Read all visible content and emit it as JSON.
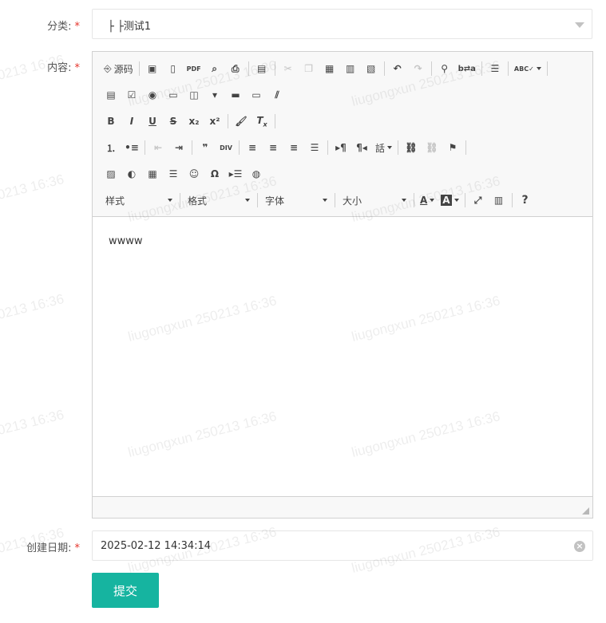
{
  "form": {
    "category_label": "分类:",
    "category_value": "├ ├测试1",
    "content_label": "内容:",
    "date_label": "创建日期:",
    "date_value": "2025-02-12 14:34:14",
    "submit_label": "提交",
    "required_mark": "*"
  },
  "editor": {
    "source_label": "源码",
    "style_label": "样式",
    "format_label": "格式",
    "font_label": "字体",
    "size_label": "大小",
    "content_text": "wwww",
    "lang_label": "話"
  },
  "watermark": {
    "line1": "liugongxun 250213 16:36",
    "line2": "0213 16:36"
  },
  "colors": {
    "accent": "#16b4a0",
    "required": "#e5342b"
  }
}
